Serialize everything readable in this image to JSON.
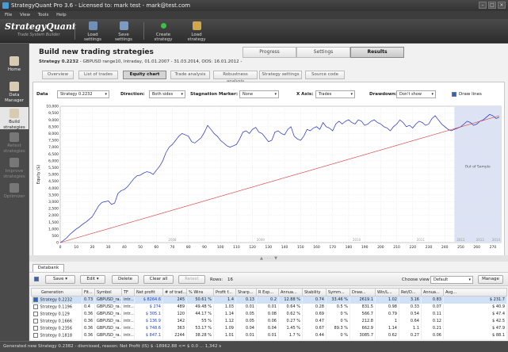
{
  "window": {
    "title": "StrategyQuant Pro  3.6 - Licensed to: mark test - mark@test.com"
  },
  "menu": [
    "File",
    "View",
    "Tools",
    "Help"
  ],
  "logo": {
    "name": "StrategyQuant",
    "tagline": "Trade System Builder"
  },
  "toolbar": [
    {
      "label": "Load settings",
      "color": "#6f8fb6"
    },
    {
      "label": "Save settings",
      "color": "#7a9cc4"
    },
    {
      "label": "Create strategy",
      "color": "#39c24a"
    },
    {
      "label": "Load strategy",
      "color": "#d0a84a"
    }
  ],
  "sidebar": [
    {
      "label": "Home",
      "label2": ""
    },
    {
      "label": "Data",
      "label2": "Manager"
    },
    {
      "label": "Build",
      "label2": "strategies"
    },
    {
      "label": "Retest",
      "label2": "strategies"
    },
    {
      "label": "Improve",
      "label2": "strategies"
    },
    {
      "label": "Optimizer",
      "label2": ""
    }
  ],
  "page": {
    "title": "Build new trading strategies",
    "strategy_name": "Strategy 0.2232",
    "strategy_info": " - GBPUSD  range10, Intraday, 01.01.2007 - 31.03.2014, OOS: 16.01.2012 -",
    "main_tabs": [
      "Progress",
      "Settings",
      "Results"
    ],
    "sub_tabs": [
      "Overview",
      "List of trades",
      "Equity chart",
      "Trade analysis",
      "Robustness analysis",
      "Strategy settings",
      "Source code"
    ]
  },
  "controls": {
    "data_label": "Data",
    "data_value": "Strategy 0.2232",
    "direction_label": "Direction:",
    "direction_value": "Both sides",
    "stagnation_label": "Stagnation Marker:",
    "stagnation_value": "None",
    "xaxis_label": "X Axis:",
    "xaxis_value": "Trades",
    "drawdown_label": "Drawdown:",
    "drawdown_value": "Don't show",
    "drawlines_label": "Draw lines"
  },
  "chart_data": {
    "type": "line",
    "ylabel": "Equity ($)",
    "xlim": [
      0,
      275
    ],
    "ylim": [
      0,
      10000
    ],
    "xticks": [
      0,
      10,
      20,
      30,
      40,
      50,
      60,
      70,
      80,
      90,
      100,
      110,
      120,
      130,
      140,
      150,
      160,
      170,
      180,
      190,
      200,
      210,
      220,
      230,
      240,
      250,
      260,
      270
    ],
    "yticks": [
      0,
      500,
      1000,
      1500,
      2000,
      2500,
      3000,
      3500,
      4000,
      4500,
      5000,
      5500,
      6000,
      6500,
      7000,
      7500,
      8000,
      8500,
      9000,
      9500,
      10000
    ],
    "year_labels": [
      {
        "x": 70,
        "text": "2008"
      },
      {
        "x": 125,
        "text": "2009"
      },
      {
        "x": 185,
        "text": "2010"
      },
      {
        "x": 225,
        "text": "2011"
      },
      {
        "x": 250,
        "text": "2012"
      },
      {
        "x": 262,
        "text": "2013"
      },
      {
        "x": 272,
        "text": "2014"
      }
    ],
    "oos_start": 246,
    "oos_label": "Out of Sample",
    "series": [
      {
        "color": "#1f2fc8",
        "x": [
          0,
          2,
          4,
          6,
          8,
          10,
          12,
          14,
          16,
          18,
          20,
          22,
          24,
          26,
          28,
          30,
          32,
          34,
          36,
          38,
          40,
          42,
          44,
          46,
          48,
          50,
          52,
          54,
          56,
          58,
          60,
          62,
          64,
          66,
          68,
          70,
          72,
          74,
          76,
          78,
          80,
          82,
          84,
          86,
          88,
          90,
          92,
          94,
          96,
          98,
          100,
          102,
          104,
          106,
          108,
          110,
          112,
          114,
          116,
          118,
          120,
          122,
          124,
          126,
          128,
          130,
          132,
          134,
          136,
          138,
          140,
          142,
          144,
          146,
          148,
          150,
          152,
          154,
          156,
          158,
          160,
          162,
          164,
          166,
          168,
          170,
          172,
          174,
          176,
          178,
          180,
          182,
          184,
          186,
          188,
          190,
          192,
          194,
          196,
          198,
          200,
          202,
          204,
          206,
          208,
          210,
          212,
          214,
          216,
          218,
          220,
          222,
          224,
          226,
          228,
          230,
          232,
          234,
          236,
          238,
          240,
          242,
          244,
          246,
          248,
          250,
          252,
          254,
          256,
          258,
          260,
          262,
          264,
          266,
          268,
          270,
          272,
          274
        ],
        "y": [
          0,
          150,
          350,
          600,
          800,
          1000,
          1150,
          1350,
          1500,
          1700,
          1900,
          2300,
          2700,
          2950,
          3000,
          3050,
          2800,
          2900,
          3600,
          3800,
          3900,
          4100,
          4400,
          4700,
          4900,
          4950,
          5100,
          5200,
          5150,
          5000,
          5300,
          5600,
          6000,
          6600,
          7000,
          7200,
          7500,
          7800,
          8000,
          7900,
          7800,
          7400,
          7300,
          7500,
          7700,
          8100,
          8600,
          8300,
          8000,
          7800,
          7500,
          7300,
          7100,
          7000,
          7100,
          7200,
          7600,
          8100,
          8200,
          8000,
          8300,
          8450,
          8100,
          8000,
          7700,
          7400,
          7500,
          8100,
          8200,
          8000,
          7900,
          8300,
          8500,
          7800,
          7600,
          7500,
          7800,
          8300,
          8200,
          8400,
          8500,
          8300,
          8800,
          8500,
          8400,
          8200,
          8700,
          8900,
          8700,
          8900,
          9000,
          8800,
          8700,
          9000,
          8900,
          8600,
          8700,
          8900,
          9000,
          8800,
          8700,
          8500,
          8400,
          8200,
          8500,
          8700,
          9000,
          8800,
          8500,
          8600,
          8400,
          8700,
          8900,
          8800,
          8600,
          8700,
          9100,
          9300,
          9000,
          8700,
          8500,
          8300,
          8200,
          8300,
          8400,
          8500,
          8700,
          8900,
          8800,
          8600,
          8700,
          8900,
          9000,
          9200,
          9400,
          9300,
          9100,
          9200
        ]
      },
      {
        "color": "#e03030",
        "x": [
          0,
          274
        ],
        "y": [
          0,
          9300
        ]
      }
    ]
  },
  "databank": {
    "tab": "Databank",
    "buttons": {
      "save": "Save",
      "edit": "Edit",
      "delete": "Delete",
      "clear": "Clear all",
      "retest": "Retest"
    },
    "rows_label": "Rows:",
    "rows_value": "16",
    "choose_view_label": "Choose view",
    "choose_view_value": "Default",
    "manage": "Manage",
    "columns": [
      "Generation",
      "Fit...",
      "Symbol",
      "TF",
      "Net profit",
      "# of trad...",
      "% Wins",
      "Profit f...",
      "Sharp...",
      "R Exp...",
      "Annua...",
      "Stability",
      "Symm...",
      "Draw...",
      "Win/L...",
      "Ret/D...",
      "Annua...",
      "Avg..."
    ],
    "rows": [
      [
        "Strategy 0.2232",
        "0.73",
        "GBPUSD_ra...",
        "intr...",
        "$ 8264.6",
        "245",
        "50.61 %",
        "1.4",
        "0.13",
        "0.2",
        "12.88 %",
        "0.74",
        "33.46 %",
        "2619.1",
        "1.02",
        "3.16",
        "0.83",
        "$ 231.7"
      ],
      [
        "Strategy 0.1196",
        "0.4",
        "GBPUSD_ra...",
        "intr...",
        "$ 274",
        "489",
        "49.48 %",
        "1.03",
        "0.01",
        "0.01",
        "0.64 %",
        "0.28",
        "0.5 %",
        "831.5",
        "0.98",
        "0.33",
        "0.07",
        "$ 40.9"
      ],
      [
        "Strategy 0.129",
        "0.36",
        "GBPUSD_ra...",
        "intr...",
        "$ 305.1",
        "120",
        "44.17 %",
        "1.14",
        "0.05",
        "0.08",
        "0.62 %",
        "0.69",
        "0 %",
        "566.7",
        "0.79",
        "0.54",
        "0.11",
        "$ 47.4"
      ],
      [
        "Strategy 0.1666",
        "0.36",
        "GBPUSD_ra...",
        "intr...",
        "$ 136.9",
        "142",
        "55 %",
        "1.12",
        "0.05",
        "0.06",
        "0.27 %",
        "0.47",
        "0 %",
        "212.8",
        "1",
        "0.64",
        "0.12",
        "$ 42.5"
      ],
      [
        "Strategy 0.2356",
        "0.36",
        "GBPUSD_ra...",
        "intr...",
        "$ 748.6",
        "363",
        "53.17 %",
        "1.09",
        "0.04",
        "0.04",
        "1.45 %",
        "0.67",
        "89.3 %",
        "662.9",
        "1.14",
        "1.1",
        "0.21",
        "$ 47.9"
      ],
      [
        "Strategy 0.1818",
        "0.36",
        "GBPUSD_ra...",
        "intr...",
        "$ 847.1",
        "2244",
        "38.28 %",
        "1.01",
        "0.01",
        "0.01",
        "1.7 %",
        "0.44",
        "0 %",
        "3085.7",
        "0.62",
        "0.27",
        "0.06",
        "$ 88.1"
      ]
    ]
  },
  "status": "Generated new Strategy 0.2382 - dismissed, reason: Net Profit (IS) $ -18962.88 <= $ 0.0   ...   1,342 s"
}
